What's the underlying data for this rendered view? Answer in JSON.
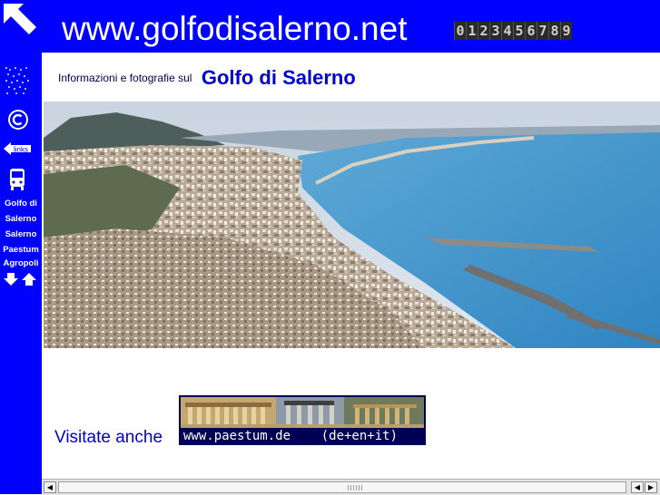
{
  "header": {
    "title": "www.golfodisalerno.net",
    "counter_digits": [
      "0",
      "1",
      "2",
      "3",
      "4",
      "5",
      "6",
      "7",
      "8",
      "9"
    ]
  },
  "sidebar": {
    "links": [
      {
        "label": "Golfo di"
      },
      {
        "label": "Salerno"
      },
      {
        "label": "Salerno"
      },
      {
        "label": "Paestum"
      },
      {
        "label": "Agropoli"
      }
    ],
    "links_icon_label": "links",
    "copyright_symbol": "©"
  },
  "intro": {
    "small_text": "Informazioni e fotografie sul",
    "big_text": "Golfo di Salerno"
  },
  "footer": {
    "visit_text": "Visitate anche",
    "banner_text": "www.paestum.de    (de+en+it)"
  },
  "colors": {
    "brand_blue": "#0000ff",
    "heading_blue": "#0000cc"
  },
  "icons": [
    "corner-arrow-icon",
    "logo-dots-icon",
    "copyright-icon",
    "links-arrow-icon",
    "bus-icon",
    "arrow-down-icon",
    "arrow-up-icon"
  ]
}
